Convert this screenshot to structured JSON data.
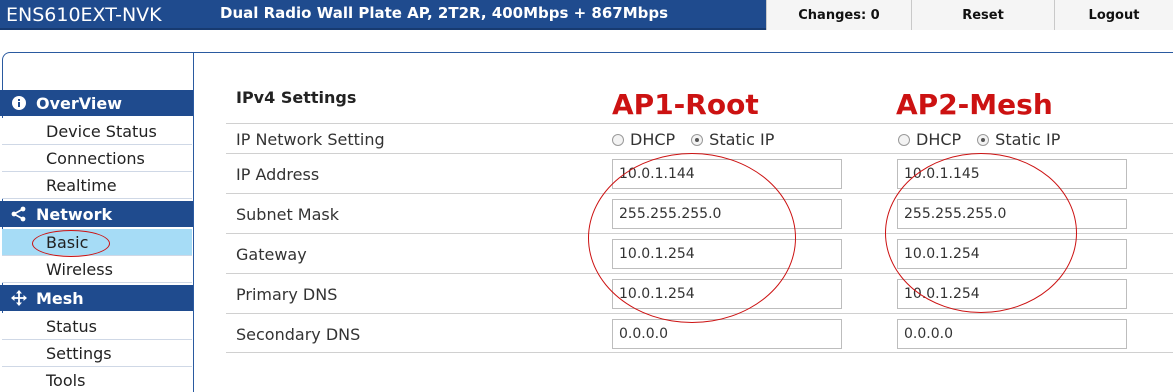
{
  "header": {
    "brand": "ENS610EXT-NVK",
    "model": "Dual Radio Wall Plate AP, 2T2R, 400Mbps + 867Mbps",
    "changes_label": "Changes: 0",
    "reset_label": "Reset",
    "logout_label": "Logout"
  },
  "sidebar": {
    "sections": [
      {
        "title": "OverView",
        "icon": "info-icon",
        "items": [
          "Device Status",
          "Connections",
          "Realtime"
        ]
      },
      {
        "title": "Network",
        "icon": "share-icon",
        "items": [
          "Basic",
          "Wireless"
        ]
      },
      {
        "title": "Mesh",
        "icon": "move-icon",
        "items": [
          "Status",
          "Settings",
          "Tools"
        ]
      }
    ],
    "active_item": "Basic"
  },
  "main": {
    "title": "IPv4 Settings",
    "ap1_label": "AP1-Root",
    "ap2_label": "AP2-Mesh",
    "rows": [
      {
        "label": "IP Network Setting"
      },
      {
        "label": "IP Address",
        "ap1": "10.0.1.144",
        "ap2": "10.0.1.145"
      },
      {
        "label": "Subnet Mask",
        "ap1": "255.255.255.0",
        "ap2": "255.255.255.0"
      },
      {
        "label": "Gateway",
        "ap1": "10.0.1.254",
        "ap2": "10.0.1.254"
      },
      {
        "label": "Primary DNS",
        "ap1": "10.0.1.254",
        "ap2": "10.0.1.254"
      },
      {
        "label": "Secondary DNS",
        "ap1": "0.0.0.0",
        "ap2": "0.0.0.0"
      }
    ],
    "radio_options": [
      "DHCP",
      "Static IP"
    ],
    "radio_selected": "Static IP"
  },
  "colors": {
    "header_bg": "#1f4b8e",
    "active_item_bg": "#a6dcf6",
    "annotation": "#cc1212"
  }
}
